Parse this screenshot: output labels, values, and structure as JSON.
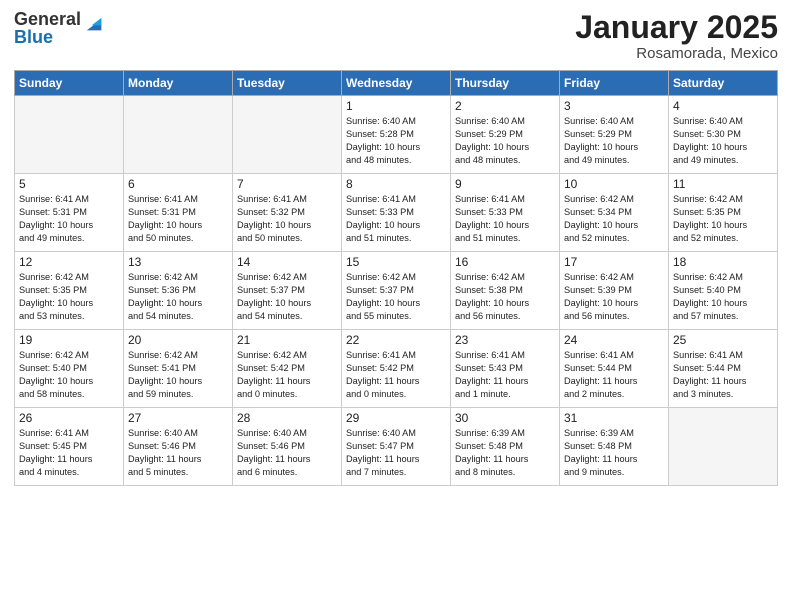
{
  "logo": {
    "general": "General",
    "blue": "Blue"
  },
  "title": "January 2025",
  "location": "Rosamorada, Mexico",
  "days_of_week": [
    "Sunday",
    "Monday",
    "Tuesday",
    "Wednesday",
    "Thursday",
    "Friday",
    "Saturday"
  ],
  "weeks": [
    [
      {
        "day": "",
        "info": ""
      },
      {
        "day": "",
        "info": ""
      },
      {
        "day": "",
        "info": ""
      },
      {
        "day": "1",
        "info": "Sunrise: 6:40 AM\nSunset: 5:28 PM\nDaylight: 10 hours\nand 48 minutes."
      },
      {
        "day": "2",
        "info": "Sunrise: 6:40 AM\nSunset: 5:29 PM\nDaylight: 10 hours\nand 48 minutes."
      },
      {
        "day": "3",
        "info": "Sunrise: 6:40 AM\nSunset: 5:29 PM\nDaylight: 10 hours\nand 49 minutes."
      },
      {
        "day": "4",
        "info": "Sunrise: 6:40 AM\nSunset: 5:30 PM\nDaylight: 10 hours\nand 49 minutes."
      }
    ],
    [
      {
        "day": "5",
        "info": "Sunrise: 6:41 AM\nSunset: 5:31 PM\nDaylight: 10 hours\nand 49 minutes."
      },
      {
        "day": "6",
        "info": "Sunrise: 6:41 AM\nSunset: 5:31 PM\nDaylight: 10 hours\nand 50 minutes."
      },
      {
        "day": "7",
        "info": "Sunrise: 6:41 AM\nSunset: 5:32 PM\nDaylight: 10 hours\nand 50 minutes."
      },
      {
        "day": "8",
        "info": "Sunrise: 6:41 AM\nSunset: 5:33 PM\nDaylight: 10 hours\nand 51 minutes."
      },
      {
        "day": "9",
        "info": "Sunrise: 6:41 AM\nSunset: 5:33 PM\nDaylight: 10 hours\nand 51 minutes."
      },
      {
        "day": "10",
        "info": "Sunrise: 6:42 AM\nSunset: 5:34 PM\nDaylight: 10 hours\nand 52 minutes."
      },
      {
        "day": "11",
        "info": "Sunrise: 6:42 AM\nSunset: 5:35 PM\nDaylight: 10 hours\nand 52 minutes."
      }
    ],
    [
      {
        "day": "12",
        "info": "Sunrise: 6:42 AM\nSunset: 5:35 PM\nDaylight: 10 hours\nand 53 minutes."
      },
      {
        "day": "13",
        "info": "Sunrise: 6:42 AM\nSunset: 5:36 PM\nDaylight: 10 hours\nand 54 minutes."
      },
      {
        "day": "14",
        "info": "Sunrise: 6:42 AM\nSunset: 5:37 PM\nDaylight: 10 hours\nand 54 minutes."
      },
      {
        "day": "15",
        "info": "Sunrise: 6:42 AM\nSunset: 5:37 PM\nDaylight: 10 hours\nand 55 minutes."
      },
      {
        "day": "16",
        "info": "Sunrise: 6:42 AM\nSunset: 5:38 PM\nDaylight: 10 hours\nand 56 minutes."
      },
      {
        "day": "17",
        "info": "Sunrise: 6:42 AM\nSunset: 5:39 PM\nDaylight: 10 hours\nand 56 minutes."
      },
      {
        "day": "18",
        "info": "Sunrise: 6:42 AM\nSunset: 5:40 PM\nDaylight: 10 hours\nand 57 minutes."
      }
    ],
    [
      {
        "day": "19",
        "info": "Sunrise: 6:42 AM\nSunset: 5:40 PM\nDaylight: 10 hours\nand 58 minutes."
      },
      {
        "day": "20",
        "info": "Sunrise: 6:42 AM\nSunset: 5:41 PM\nDaylight: 10 hours\nand 59 minutes."
      },
      {
        "day": "21",
        "info": "Sunrise: 6:42 AM\nSunset: 5:42 PM\nDaylight: 11 hours\nand 0 minutes."
      },
      {
        "day": "22",
        "info": "Sunrise: 6:41 AM\nSunset: 5:42 PM\nDaylight: 11 hours\nand 0 minutes."
      },
      {
        "day": "23",
        "info": "Sunrise: 6:41 AM\nSunset: 5:43 PM\nDaylight: 11 hours\nand 1 minute."
      },
      {
        "day": "24",
        "info": "Sunrise: 6:41 AM\nSunset: 5:44 PM\nDaylight: 11 hours\nand 2 minutes."
      },
      {
        "day": "25",
        "info": "Sunrise: 6:41 AM\nSunset: 5:44 PM\nDaylight: 11 hours\nand 3 minutes."
      }
    ],
    [
      {
        "day": "26",
        "info": "Sunrise: 6:41 AM\nSunset: 5:45 PM\nDaylight: 11 hours\nand 4 minutes."
      },
      {
        "day": "27",
        "info": "Sunrise: 6:40 AM\nSunset: 5:46 PM\nDaylight: 11 hours\nand 5 minutes."
      },
      {
        "day": "28",
        "info": "Sunrise: 6:40 AM\nSunset: 5:46 PM\nDaylight: 11 hours\nand 6 minutes."
      },
      {
        "day": "29",
        "info": "Sunrise: 6:40 AM\nSunset: 5:47 PM\nDaylight: 11 hours\nand 7 minutes."
      },
      {
        "day": "30",
        "info": "Sunrise: 6:39 AM\nSunset: 5:48 PM\nDaylight: 11 hours\nand 8 minutes."
      },
      {
        "day": "31",
        "info": "Sunrise: 6:39 AM\nSunset: 5:48 PM\nDaylight: 11 hours\nand 9 minutes."
      },
      {
        "day": "",
        "info": ""
      }
    ]
  ]
}
